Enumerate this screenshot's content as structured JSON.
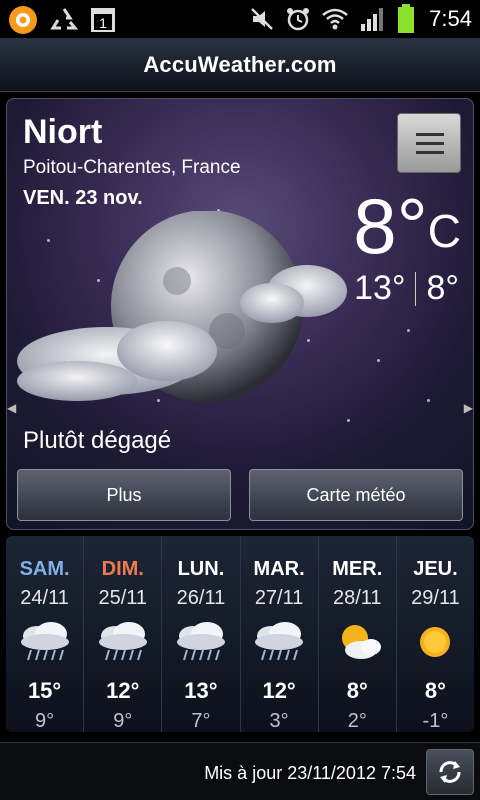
{
  "statusbar": {
    "time": "7:54",
    "left_icons": [
      "orange-app-icon",
      "recycle-icon",
      "calendar-icon"
    ],
    "right_icons": [
      "mute-icon",
      "alarm-icon",
      "wifi-icon",
      "signal-icon",
      "battery-icon"
    ]
  },
  "header": {
    "brand": "AccuWeather.com"
  },
  "current": {
    "city": "Niort",
    "region": "Poitou-Charentes, France",
    "date": "VEN. 23 nov.",
    "temp": "8°",
    "unit": "C",
    "high": "13°",
    "low": "8°",
    "condition": "Plutôt dégagé",
    "icon": "moon-clouds-icon"
  },
  "buttons": {
    "more": "Plus",
    "map": "Carte météo"
  },
  "forecast": [
    {
      "day": "SAM.",
      "date": "24/11",
      "hi": "15°",
      "lo": "9°",
      "icon": "rain-cloud-icon",
      "color": "#7fb0e8"
    },
    {
      "day": "DIM.",
      "date": "25/11",
      "hi": "12°",
      "lo": "9°",
      "icon": "rain-cloud-icon",
      "color": "#f07a50"
    },
    {
      "day": "LUN.",
      "date": "26/11",
      "hi": "13°",
      "lo": "7°",
      "icon": "rain-cloud-icon",
      "color": "#ffffff"
    },
    {
      "day": "MAR.",
      "date": "27/11",
      "hi": "12°",
      "lo": "3°",
      "icon": "rain-cloud-icon",
      "color": "#ffffff"
    },
    {
      "day": "MER.",
      "date": "28/11",
      "hi": "8°",
      "lo": "2°",
      "icon": "sun-cloud-icon",
      "color": "#ffffff"
    },
    {
      "day": "JEU.",
      "date": "29/11",
      "hi": "8°",
      "lo": "-1°",
      "icon": "sun-icon",
      "color": "#ffffff"
    }
  ],
  "footer": {
    "updated": "Mis à jour 23/11/2012 7:54"
  },
  "colors": {
    "accent_blue": "#7fb0e8",
    "accent_orange": "#f07a50",
    "battery": "#8be02a"
  }
}
